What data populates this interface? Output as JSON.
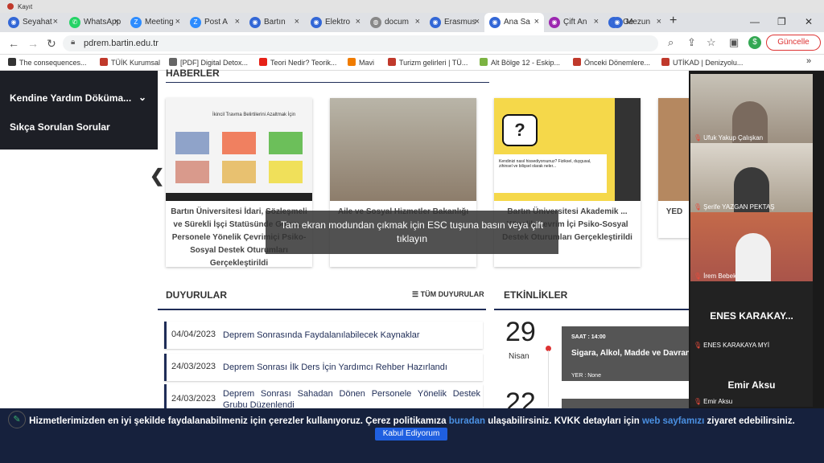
{
  "recording": {
    "label": "Kayıt"
  },
  "tabs": [
    {
      "label": "Seyahat",
      "icon": "site-icon"
    },
    {
      "label": "WhatsApp",
      "icon": "whatsapp-icon"
    },
    {
      "label": "Meeting",
      "icon": "zoom-icon"
    },
    {
      "label": "Post A",
      "icon": "zoom-icon"
    },
    {
      "label": "Bartın",
      "icon": "site-icon"
    },
    {
      "label": "Elektro",
      "icon": "site-icon"
    },
    {
      "label": "docum",
      "icon": "globe-icon"
    },
    {
      "label": "Erasmus",
      "icon": "site-icon"
    },
    {
      "label": "Ana Sa",
      "icon": "site-icon"
    },
    {
      "label": "Çift An",
      "icon": "site-icon"
    },
    {
      "label": "Ge",
      "icon": "site-icon"
    },
    {
      "label": "Mezun",
      "icon": "site-icon"
    }
  ],
  "address": {
    "url": "pdrem.bartin.edu.tr"
  },
  "update_button": "Güncelle",
  "profile_initial": "$",
  "bookmarks": [
    {
      "label": "The consequences...",
      "color": "#333333"
    },
    {
      "label": "TÜİK Kurumsal",
      "color": "#c0392b"
    },
    {
      "label": "[PDF] Digital Detox...",
      "color": "#666666"
    },
    {
      "label": "Teori Nedir? Teorik...",
      "color": "#e62117"
    },
    {
      "label": "Mavi",
      "color": "#f07c00"
    },
    {
      "label": "Turizm gelirleri | TÜ...",
      "color": "#c0392b"
    },
    {
      "label": "Alt Bölge 12 - Eskip...",
      "color": "#7cb342"
    },
    {
      "label": "Önceki Dönemlere...",
      "color": "#c0392b"
    },
    {
      "label": "UTİKAD | Denizyolu...",
      "color": "#c0392b"
    }
  ],
  "sidebar": {
    "items": [
      {
        "label": "Kendine Yardım Döküma..."
      },
      {
        "label": "Sıkça Sorulan Sorular"
      }
    ]
  },
  "news": {
    "title": "HABERLER",
    "items": [
      {
        "caption": "Bartın Üniversitesi İdari, Sözleşmeli ve Sürekli İşçi Statüsünde Görev... Personele Yönelik Çevrimiçi Psiko-Sosyal Destek Oturumları Gerçekleştirildi",
        "slide_title": "İkincil Travma Belirtilerini Azaltmak İçin"
      },
      {
        "caption": "Aile ve Sosyal Hizmetler Bakanlığı"
      },
      {
        "caption": "Bartın Üniversitesi Akademik ... Yönelik Çevrim İçi Psiko-Sosyal Destek Oturumları Gerçekleştirildi",
        "slide_text": "Kendinizi nasıl hissediyorsunuz? Fiziksel, duygusal, zihinsel ve bilişsel olarak neler..."
      },
      {
        "caption": "YED"
      }
    ]
  },
  "fullscreen_toast": "Tam ekran modundan çıkmak için ESC tuşuna basın veya çift tıklayın",
  "announcements": {
    "title": "DUYURULAR",
    "all_link": "TÜM DUYURULAR",
    "items": [
      {
        "date": "04/04/2023",
        "title": "Deprem Sonrasında Faydalanılabilecek Kaynaklar"
      },
      {
        "date": "24/03/2023",
        "title": "Deprem Sonrası İlk Ders İçin Yardımcı Rehber Hazırlandı"
      },
      {
        "date": "24/03/2023",
        "title": "Deprem Sonrası Sahadan Dönen Personele Yönelik Destek Grubu Düzenlendi"
      }
    ]
  },
  "events": {
    "title": "ETKİNLİKLER",
    "items": [
      {
        "day": "29",
        "month": "Nisan",
        "time": "SAAT : 14:00",
        "title": "Sigara, Alkol, Madde ve Davranış",
        "place": "YER : None"
      },
      {
        "day": "22",
        "month": ""
      }
    ]
  },
  "participants": [
    {
      "name": "Ufuk Yakup Çalışkan",
      "video": true
    },
    {
      "name": "Şerife YAZGAN PEKTAŞ",
      "video": true
    },
    {
      "name": "İrem Bebek",
      "video": true
    },
    {
      "name": "ENES KARAKAYA MYİ",
      "display": "ENES KARAKAY...",
      "video": false
    },
    {
      "name": "Emir Aksu",
      "display": "Emir Aksu",
      "video": false
    }
  ],
  "cookie": {
    "text_before": "Hizmetlerimizden en iyi şekilde faydalanabilmeniz için çerezler kullanıyoruz. Çerez politikamıza ",
    "link1": "buradan",
    "text_mid": " ulaşabilirsiniz. KVKK detayları için ",
    "link2": "web sayfamızı",
    "text_after": " ziyaret edebilirsiniz.",
    "accept": "Kabul Ediyorum"
  }
}
